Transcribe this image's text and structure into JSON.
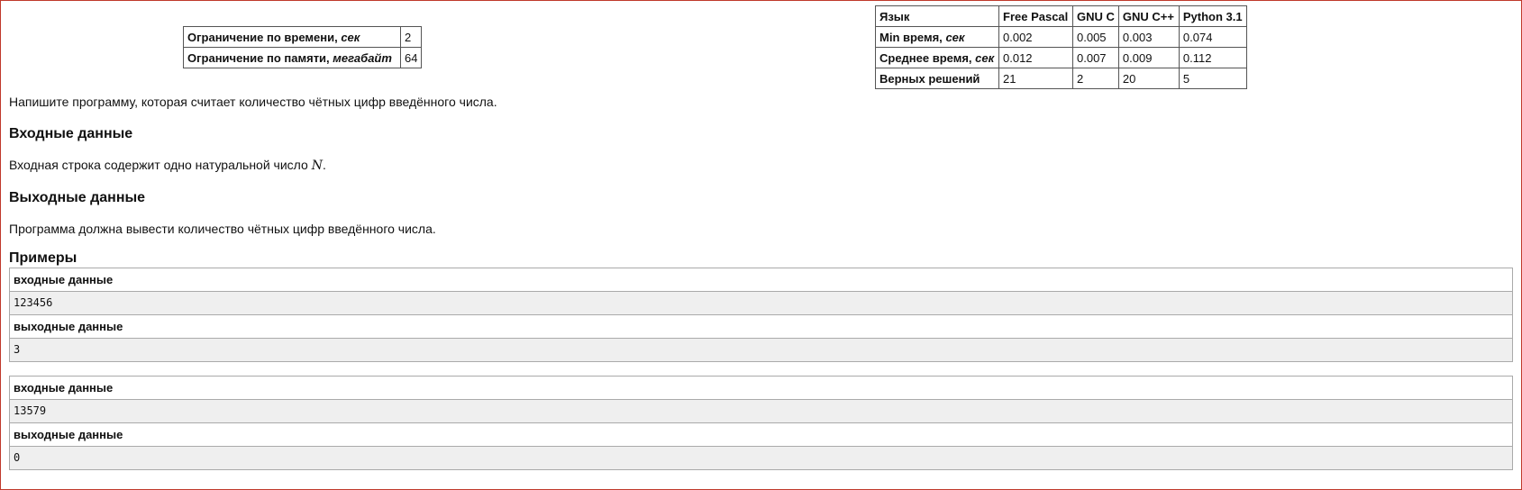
{
  "limits": {
    "time_label": "Ограничение по времени,",
    "time_unit": "сек",
    "time_value": "2",
    "memory_label": "Ограничение по памяти,",
    "memory_unit": "мегабайт",
    "memory_value": "64"
  },
  "stats": {
    "header": [
      "Язык",
      "Free Pascal",
      "GNU C",
      "GNU C++",
      "Python 3.1"
    ],
    "rows": [
      {
        "label": "Min время,",
        "unit": "сек",
        "values": [
          "0.002",
          "0.005",
          "0.003",
          "0.074"
        ]
      },
      {
        "label": "Среднее время,",
        "unit": "сек",
        "values": [
          "0.012",
          "0.007",
          "0.009",
          "0.112"
        ]
      },
      {
        "label": "Верных решений",
        "unit": "",
        "values": [
          "21",
          "2",
          "20",
          "5"
        ]
      }
    ]
  },
  "statement": "Напишите программу, которая считает количество чётных цифр введённого числа.",
  "input_section": {
    "title": "Входные данные",
    "text_before": "Входная строка содержит одно натуральной число",
    "math": "N",
    "text_after": "."
  },
  "output_section": {
    "title": "Выходные данные",
    "text": "Программа должна вывести количество чётных цифр введённого числа."
  },
  "examples": {
    "title": "Примеры",
    "input_label": "входные данные",
    "output_label": "выходные данные",
    "items": [
      {
        "input": "123456",
        "output": "3"
      },
      {
        "input": "13579",
        "output": "0"
      }
    ]
  }
}
